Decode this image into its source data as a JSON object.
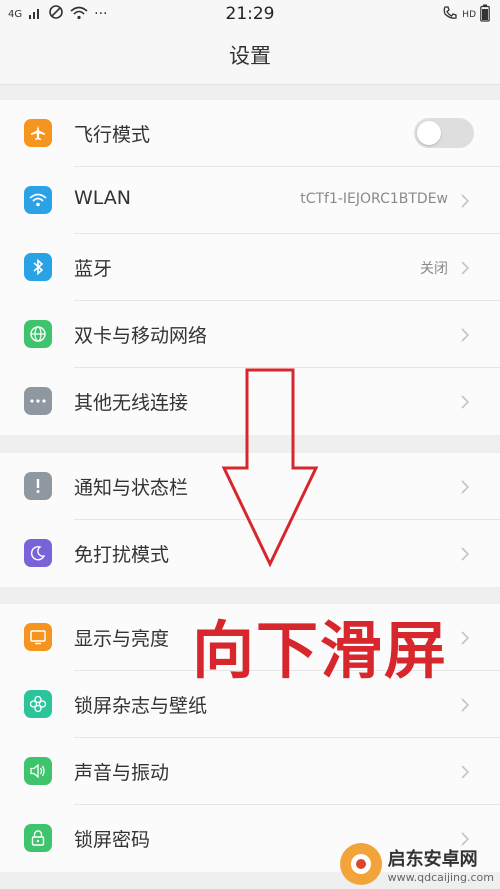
{
  "status": {
    "left_text": "4G",
    "time": "21:29",
    "right_text": "HD"
  },
  "title": "设置",
  "groups": [
    {
      "items": [
        {
          "label": "飞行模式",
          "icon": "airplane-icon",
          "icon_color": "#f5941f",
          "control": "toggle",
          "toggle_on": false
        },
        {
          "label": "WLAN",
          "icon": "wifi-icon",
          "icon_color": "#2aa3e6",
          "value": "tCTf1-IEJORC1BTDEw"
        },
        {
          "label": "蓝牙",
          "icon": "bluetooth-icon",
          "icon_color": "#2aa3e6",
          "value": "关闭"
        },
        {
          "label": "双卡与移动网络",
          "icon": "globe-icon",
          "icon_color": "#3ec46d"
        },
        {
          "label": "其他无线连接",
          "icon": "more-dots-icon",
          "icon_color": "#8f97a0"
        }
      ]
    },
    {
      "items": [
        {
          "label": "通知与状态栏",
          "icon": "exclamation-icon",
          "icon_color": "#8f97a0"
        },
        {
          "label": "免打扰模式",
          "icon": "moon-icon",
          "icon_color": "#7a62d8"
        }
      ]
    },
    {
      "items": [
        {
          "label": "显示与亮度",
          "icon": "monitor-icon",
          "icon_color": "#f5941f"
        },
        {
          "label": "锁屏杂志与壁纸",
          "icon": "flower-icon",
          "icon_color": "#2cc49a"
        },
        {
          "label": "声音与振动",
          "icon": "speaker-icon",
          "icon_color": "#3ec46d"
        },
        {
          "label": "锁屏密码",
          "icon": "lock-icon",
          "icon_color": "#3ec46d"
        }
      ]
    }
  ],
  "overlay": {
    "text": "向下滑屏",
    "color": "#d8262d"
  },
  "watermark": {
    "title": "启东安卓网",
    "url": "www.qdcaijing.com"
  }
}
